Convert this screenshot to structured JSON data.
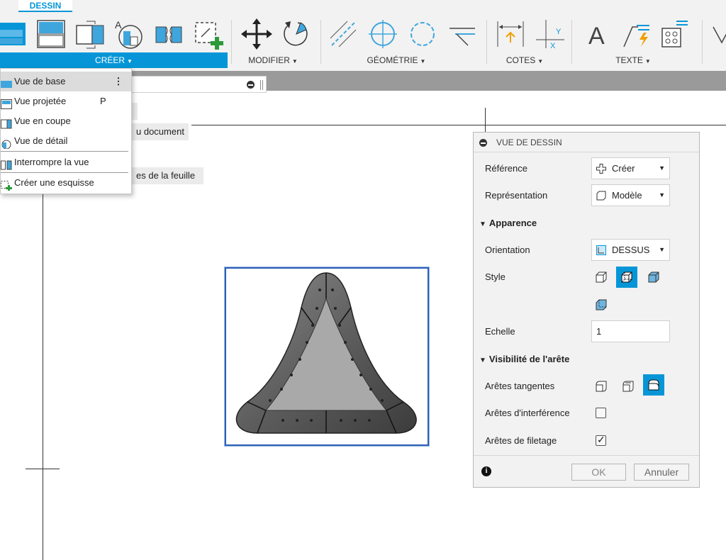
{
  "ribbon": {
    "tab": "DESSIN",
    "groups": {
      "creer": "CRÉER",
      "modifier": "MODIFIER",
      "geometrie": "GÉOMÉTRIE",
      "cotes": "COTES",
      "texte": "TEXTE"
    },
    "accent_color": "#0696d7",
    "tools": [
      "base-view-icon",
      "projected-view-icon",
      "section-view-icon",
      "detail-view-icon",
      "break-view-icon",
      "sketch-icon",
      "move-icon",
      "rotate-icon",
      "centerline-icon",
      "center-mark-icon",
      "circle-icon",
      "leader-icon",
      "dimension-icon",
      "ordinate-icon",
      "text-icon",
      "note-icon",
      "table-icon",
      "filter-icon"
    ]
  },
  "menu": {
    "items": [
      {
        "label": "Vue de base",
        "shortcut": "",
        "icon": "base-view-icon"
      },
      {
        "label": "Vue projetée",
        "shortcut": "P",
        "icon": "projected-view-icon"
      },
      {
        "label": "Vue en coupe",
        "shortcut": "",
        "icon": "section-view-icon"
      },
      {
        "label": "Vue de détail",
        "shortcut": "",
        "icon": "detail-view-icon"
      },
      {
        "label": "Interrompre la vue",
        "shortcut": "",
        "icon": "break-view-icon"
      },
      {
        "label": "Créer une esquisse",
        "shortcut": "",
        "icon": "sketch-icon"
      }
    ],
    "more_label": "⋮"
  },
  "browser": {
    "chip_document": "u document",
    "chip_sheet": "es de la feuille"
  },
  "dialog": {
    "title": "VUE DE DESSIN",
    "reference_label": "Référence",
    "reference_value": "Créer",
    "representation_label": "Représentation",
    "representation_value": "Modèle",
    "appearance_section": "Apparence",
    "orientation_label": "Orientation",
    "orientation_value": "DESSUS",
    "style_label": "Style",
    "scale_label": "Echelle",
    "scale_value": "1",
    "edge_section": "Visibilité de l'arête",
    "tangent_label": "Arêtes tangentes",
    "interference_label": "Arêtes d'interférence",
    "interference_checked": false,
    "thread_label": "Arêtes de filetage",
    "thread_checked": true,
    "ok_label": "OK",
    "cancel_label": "Annuler",
    "info_glyph": "i"
  }
}
